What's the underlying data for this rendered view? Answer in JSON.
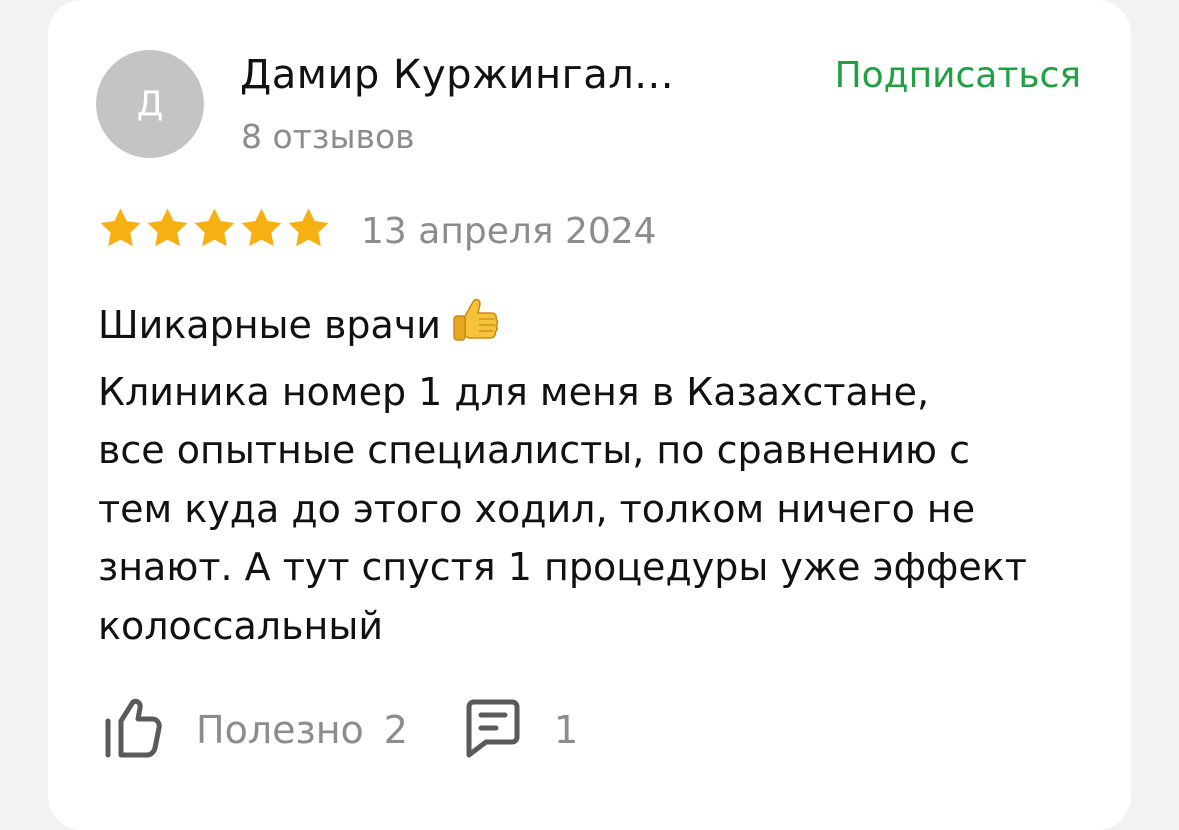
{
  "author": {
    "initial": "Д",
    "name": "Дамир Куржингал...",
    "reviews_count": "8 отзывов",
    "subscribe_label": "Подписаться"
  },
  "review": {
    "rating": 5,
    "max_rating": 5,
    "date": "13 апреля 2024",
    "lines": [
      "Шикарные врачи",
      "Клиника номер 1 для меня в Казахстане,",
      "все опытные специалисты, по сравнению с",
      "тем куда до этого ходил, толком ничего не",
      "знают. А тут спустя 1 процедуры уже эффект",
      "колоссальный"
    ]
  },
  "actions": {
    "useful_label": "Полезно",
    "useful_count": "2",
    "comments_count": "1"
  },
  "icons": {
    "star": "star-icon",
    "thumbs_up_emoji": "thumbs-up-emoji-icon",
    "like": "like-icon",
    "comment": "comment-icon"
  },
  "colors": {
    "accent_green": "#1fa043",
    "star_gold": "#f6b012",
    "secondary_text": "#8c8c8c",
    "avatar_bg": "#c4c4c4"
  }
}
